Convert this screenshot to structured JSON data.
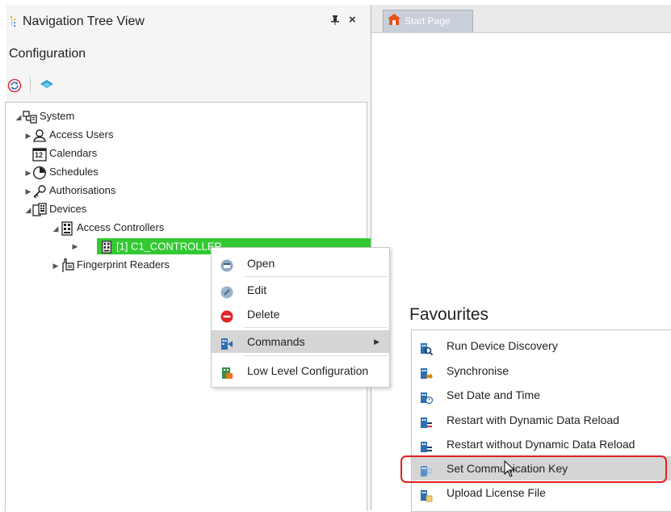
{
  "nav_panel": {
    "title": "Navigation Tree View",
    "pin_glyph": "Ȅ",
    "close_glyph": "×",
    "section_label": "Configuration",
    "toolbar": [
      {
        "icon": "refresh-icon"
      },
      {
        "icon": "layers-icon"
      }
    ]
  },
  "tree": {
    "system": "System",
    "access_users": "Access Users",
    "calendars": "Calendars",
    "calendars_icon_text": "12",
    "schedules": "Schedules",
    "authorisations": "Authorisations",
    "devices": "Devices",
    "access_controllers": "Access Controllers",
    "controller": "[1] C1_CONTROLLER",
    "fingerprint_readers": "Fingerprint Readers"
  },
  "tabs": {
    "start_page": "Start Page"
  },
  "favourites_title": "Favourites",
  "context_menu": {
    "open": "Open",
    "edit": "Edit",
    "delete": "Delete",
    "commands": "Commands",
    "low_level": "Low Level Configuration"
  },
  "submenu": {
    "run_discovery": "Run Device Discovery",
    "synchronise": "Synchronise",
    "set_date_time": "Set Date and Time",
    "restart_with": "Restart with Dynamic Data Reload",
    "restart_without": "Restart without Dynamic Data Reload",
    "set_comm_key": "Set Communication Key",
    "upload_license": "Upload License File"
  },
  "colors": {
    "selection_green": "#32c932",
    "highlight_red": "#e02020",
    "menu_hover": "#d5d5d5"
  }
}
